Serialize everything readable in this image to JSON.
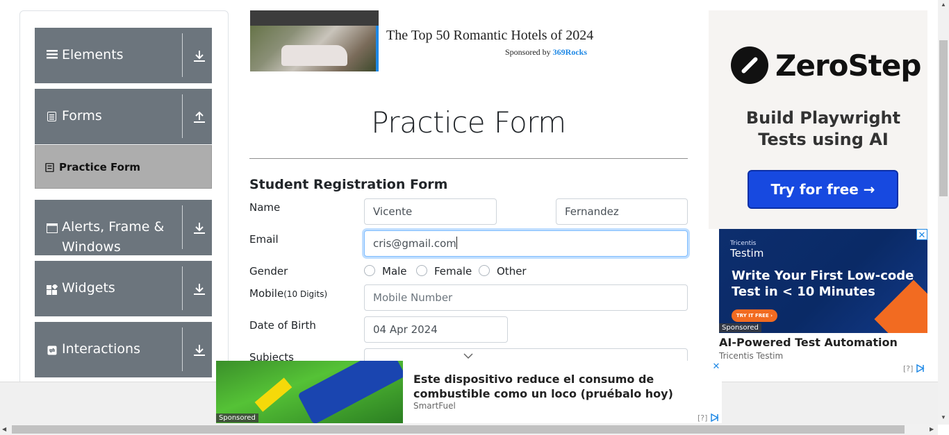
{
  "sidebar": {
    "groups": [
      {
        "label": "Elements",
        "icon": "hamburger-icon",
        "arrow": "download-icon"
      },
      {
        "label": "Forms",
        "icon": "document-icon",
        "arrow": "upload-icon"
      },
      {
        "label": "Alerts, Frame & Windows",
        "icon": "window-icon",
        "arrow": "download-icon"
      },
      {
        "label": "Widgets",
        "icon": "widgets-icon",
        "arrow": "download-icon"
      },
      {
        "label": "Interactions",
        "icon": "interactions-icon",
        "arrow": "download-icon"
      }
    ],
    "active_item": {
      "label": "Practice Form",
      "icon": "form-icon"
    }
  },
  "top_ad": {
    "title": "The Top 50 Romantic Hotels of 2024",
    "sponsored_prefix": "Sponsored by",
    "sponsor": "369Rocks"
  },
  "form": {
    "page_title": "Practice Form",
    "section_title": "Student Registration Form",
    "labels": {
      "name": "Name",
      "email": "Email",
      "gender": "Gender",
      "mobile": "Mobile",
      "mobile_hint": "(10 Digits)",
      "dob": "Date of Birth",
      "subjects": "Subjects"
    },
    "first_name": "Vicente",
    "last_name": "Fernandez",
    "email": "cris@gmail.com",
    "gender_options": [
      "Male",
      "Female",
      "Other"
    ],
    "mobile_placeholder": "Mobile Number",
    "dob": "04 Apr 2024"
  },
  "right_ad": {
    "brand": "ZeroStep",
    "headline_line1": "Build Playwright",
    "headline_line2": "Tests using AI",
    "button": "Try for free →"
  },
  "testim_ad": {
    "brand_small": "Tricentis",
    "brand": "Testim",
    "headline_line1": "Write Your First Low-code",
    "headline_line2": "Test in < 10 Minutes",
    "cta": "TRY IT FREE ›",
    "sponsored": "Sponsored",
    "title": "AI-Powered Test Automation",
    "subtitle": "Tricentis Testim",
    "info": "[?]"
  },
  "bottom_ad": {
    "text": "Este dispositivo reduce el consumo de combustible como un loco (pruébalo hoy)",
    "brand": "SmartFuel",
    "sponsored": "Sponsored",
    "info": "[?]"
  },
  "colors": {
    "sidebar_group": "#6c757d",
    "active_item": "#adadad",
    "focus_border": "#80bdff",
    "ad_button": "#1749e0",
    "testim_bg": "#0d2e6e",
    "testim_accent": "#f26b21"
  }
}
